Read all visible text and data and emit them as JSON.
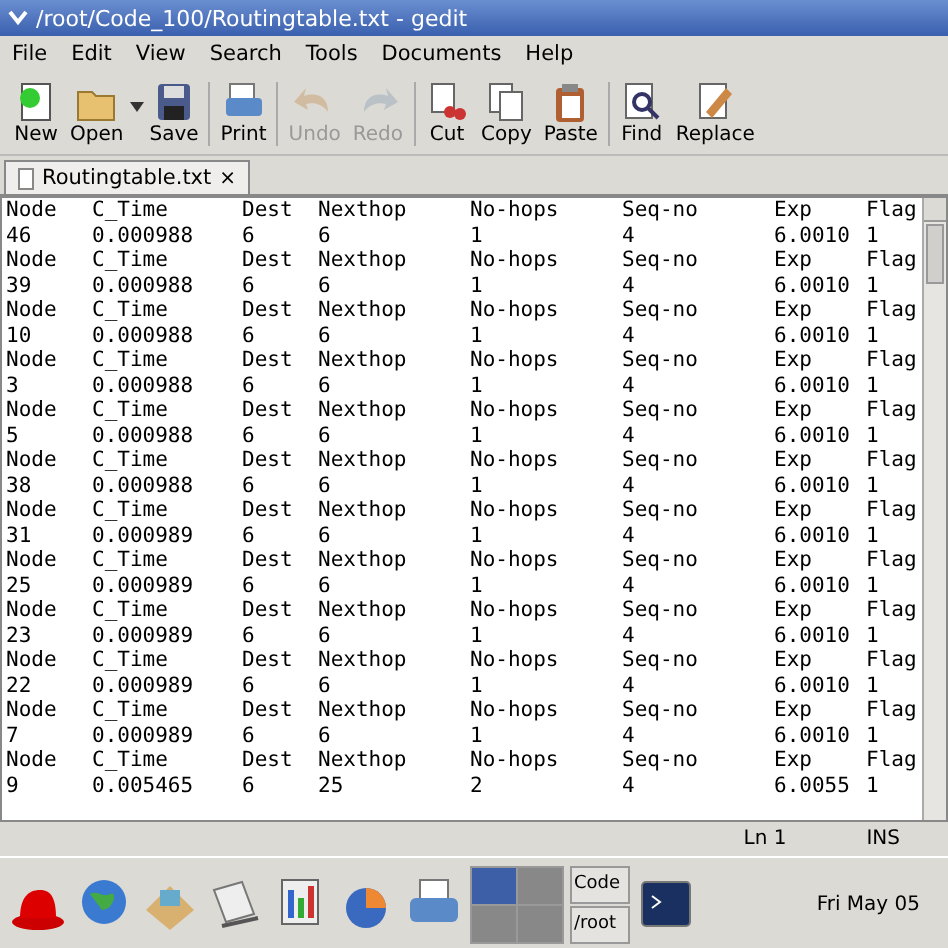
{
  "window": {
    "title": "/root/Code_100/Routingtable.txt - gedit"
  },
  "menu": [
    "File",
    "Edit",
    "View",
    "Search",
    "Tools",
    "Documents",
    "Help"
  ],
  "toolbar": [
    [
      {
        "label": "New",
        "disabled": false,
        "dropdown": false
      },
      {
        "label": "Open",
        "disabled": false,
        "dropdown": true
      },
      {
        "label": "Save",
        "disabled": false,
        "dropdown": false
      }
    ],
    [
      {
        "label": "Print",
        "disabled": false,
        "dropdown": false
      }
    ],
    [
      {
        "label": "Undo",
        "disabled": true,
        "dropdown": false
      },
      {
        "label": "Redo",
        "disabled": true,
        "dropdown": false
      }
    ],
    [
      {
        "label": "Cut",
        "disabled": false,
        "dropdown": false
      },
      {
        "label": "Copy",
        "disabled": false,
        "dropdown": false
      },
      {
        "label": "Paste",
        "disabled": false,
        "dropdown": false
      }
    ],
    [
      {
        "label": "Find",
        "disabled": false,
        "dropdown": false
      },
      {
        "label": "Replace",
        "disabled": false,
        "dropdown": false
      }
    ]
  ],
  "tabs": [
    {
      "label": "Routingtable.txt",
      "close": "×",
      "selected": true
    }
  ],
  "document": {
    "lines": [
      [
        "Node",
        "C_Time",
        "Dest",
        "Nexthop",
        "No-hops",
        "Seq-no",
        "Exp",
        "Flag"
      ],
      [
        "46",
        "0.000988",
        "6",
        "6",
        "1",
        "4",
        "6.0010",
        "1"
      ],
      [
        "Node",
        "C_Time",
        "Dest",
        "Nexthop",
        "No-hops",
        "Seq-no",
        "Exp",
        "Flag"
      ],
      [
        "39",
        "0.000988",
        "6",
        "6",
        "1",
        "4",
        "6.0010",
        "1"
      ],
      [
        "Node",
        "C_Time",
        "Dest",
        "Nexthop",
        "No-hops",
        "Seq-no",
        "Exp",
        "Flag"
      ],
      [
        "10",
        "0.000988",
        "6",
        "6",
        "1",
        "4",
        "6.0010",
        "1"
      ],
      [
        "Node",
        "C_Time",
        "Dest",
        "Nexthop",
        "No-hops",
        "Seq-no",
        "Exp",
        "Flag"
      ],
      [
        "3",
        "0.000988",
        "6",
        "6",
        "1",
        "4",
        "6.0010",
        "1"
      ],
      [
        "Node",
        "C_Time",
        "Dest",
        "Nexthop",
        "No-hops",
        "Seq-no",
        "Exp",
        "Flag"
      ],
      [
        "5",
        "0.000988",
        "6",
        "6",
        "1",
        "4",
        "6.0010",
        "1"
      ],
      [
        "Node",
        "C_Time",
        "Dest",
        "Nexthop",
        "No-hops",
        "Seq-no",
        "Exp",
        "Flag"
      ],
      [
        "38",
        "0.000988",
        "6",
        "6",
        "1",
        "4",
        "6.0010",
        "1"
      ],
      [
        "Node",
        "C_Time",
        "Dest",
        "Nexthop",
        "No-hops",
        "Seq-no",
        "Exp",
        "Flag"
      ],
      [
        "31",
        "0.000989",
        "6",
        "6",
        "1",
        "4",
        "6.0010",
        "1"
      ],
      [
        "Node",
        "C_Time",
        "Dest",
        "Nexthop",
        "No-hops",
        "Seq-no",
        "Exp",
        "Flag"
      ],
      [
        "25",
        "0.000989",
        "6",
        "6",
        "1",
        "4",
        "6.0010",
        "1"
      ],
      [
        "Node",
        "C_Time",
        "Dest",
        "Nexthop",
        "No-hops",
        "Seq-no",
        "Exp",
        "Flag"
      ],
      [
        "23",
        "0.000989",
        "6",
        "6",
        "1",
        "4",
        "6.0010",
        "1"
      ],
      [
        "Node",
        "C_Time",
        "Dest",
        "Nexthop",
        "No-hops",
        "Seq-no",
        "Exp",
        "Flag"
      ],
      [
        "22",
        "0.000989",
        "6",
        "6",
        "1",
        "4",
        "6.0010",
        "1"
      ],
      [
        "Node",
        "C_Time",
        "Dest",
        "Nexthop",
        "No-hops",
        "Seq-no",
        "Exp",
        "Flag"
      ],
      [
        "7",
        "0.000989",
        "6",
        "6",
        "1",
        "4",
        "6.0010",
        "1"
      ],
      [
        "Node",
        "C_Time",
        "Dest",
        "Nexthop",
        "No-hops",
        "Seq-no",
        "Exp",
        "Flag"
      ],
      [
        "9",
        "0.005465",
        "6",
        "25",
        "2",
        "4",
        "6.0055",
        "1"
      ]
    ]
  },
  "status_bar": {
    "position": "Ln 1",
    "mode": "INS"
  },
  "taskbar": {
    "workspaces": [
      {
        "selected": true
      },
      {
        "selected": false
      },
      {
        "selected": false
      },
      {
        "selected": false
      }
    ],
    "tasks": [
      {
        "label": "Code"
      },
      {
        "label": "/root"
      }
    ],
    "clock": "Fri May 05"
  }
}
